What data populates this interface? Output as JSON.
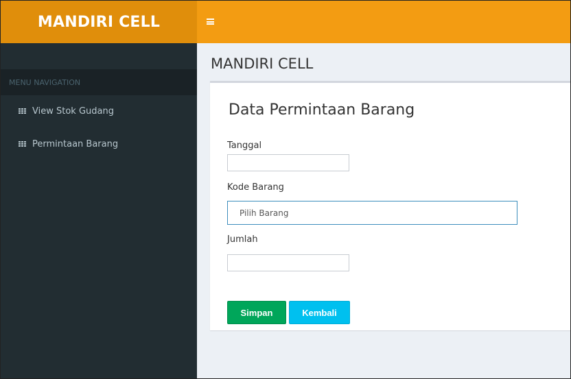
{
  "app": {
    "name": "MANDIRI CELL"
  },
  "sidebar": {
    "header": "MENU NAVIGATION",
    "items": [
      {
        "label": "View Stok Gudang",
        "icon": "grid-icon"
      },
      {
        "label": "Permintaan Barang",
        "icon": "grid-icon"
      }
    ]
  },
  "main": {
    "page_title": "MANDIRI CELL",
    "form": {
      "title": "Data Permintaan Barang",
      "fields": {
        "tanggal_label": "Tanggal",
        "tanggal_value": "",
        "kode_label": "Kode Barang",
        "kode_selected": "Pilih Barang",
        "jumlah_label": "Jumlah",
        "jumlah_value": ""
      },
      "buttons": {
        "save": "Simpan",
        "back": "Kembali"
      }
    }
  },
  "colors": {
    "logo_bg": "#e08e0b",
    "topbar_bg": "#f39c12",
    "sidebar_bg": "#222d32",
    "save_button": "#00a65a",
    "back_button": "#00c0ef",
    "focus_border": "#3c8dbc"
  }
}
